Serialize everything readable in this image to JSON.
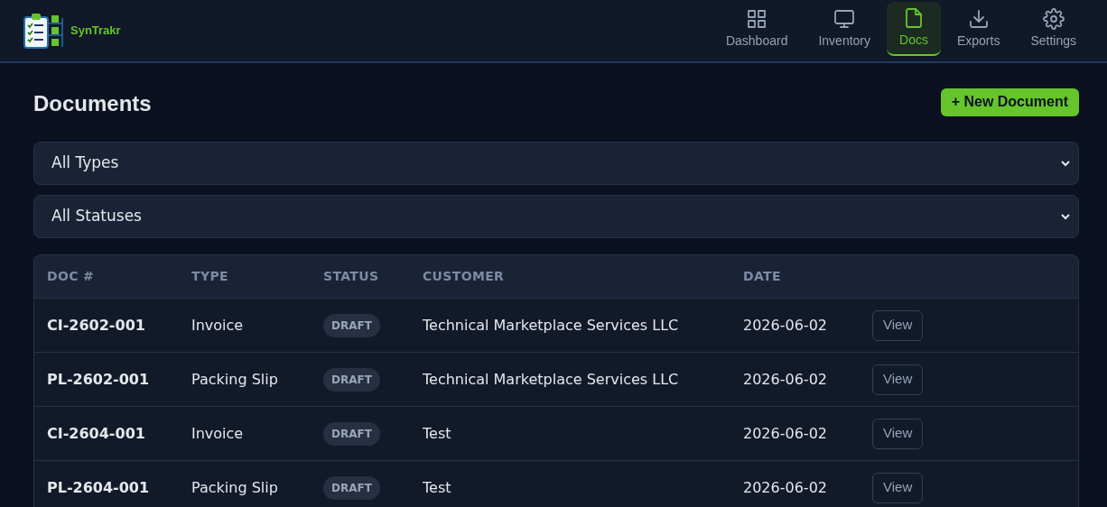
{
  "app": {
    "name": "SynTrakr"
  },
  "nav": [
    {
      "label": "Dashboard",
      "selected": false
    },
    {
      "label": "Inventory",
      "selected": false
    },
    {
      "label": "Docs",
      "selected": true
    },
    {
      "label": "Exports",
      "selected": false
    },
    {
      "label": "Settings",
      "selected": false
    }
  ],
  "page": {
    "title": "Documents",
    "new_button": "+ New Document"
  },
  "filters": [
    {
      "value": "All Types"
    },
    {
      "value": "All Statuses"
    }
  ],
  "table": {
    "columns": [
      "DOC #",
      "TYPE",
      "STATUS",
      "CUSTOMER",
      "DATE"
    ],
    "rows": [
      {
        "doc": "CI-2602-001",
        "type": "Invoice",
        "status": "DRAFT",
        "customer": "Technical Marketplace Services LLC",
        "date": "2026-06-02",
        "action": "View"
      },
      {
        "doc": "PL-2602-001",
        "type": "Packing Slip",
        "status": "DRAFT",
        "customer": "Technical Marketplace Services LLC",
        "date": "2026-06-02",
        "action": "View"
      },
      {
        "doc": "CI-2604-001",
        "type": "Invoice",
        "status": "DRAFT",
        "customer": "Test",
        "date": "2026-06-02",
        "action": "View"
      },
      {
        "doc": "PL-2604-001",
        "type": "Packing Slip",
        "status": "DRAFT",
        "customer": "Test",
        "date": "2026-06-02",
        "action": "View"
      }
    ]
  }
}
